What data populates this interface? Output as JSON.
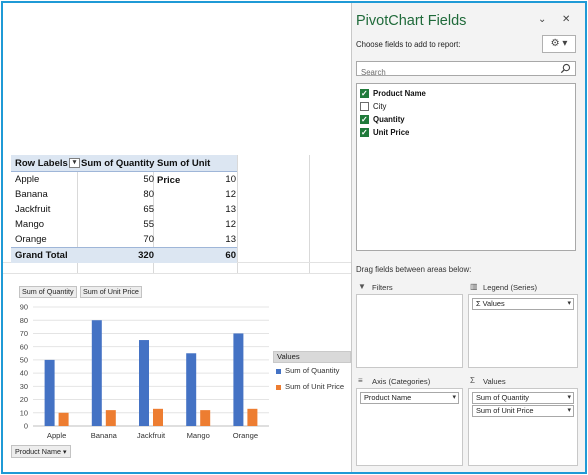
{
  "pivot_table": {
    "headers": [
      "Row Labels",
      "Sum of Quantity",
      "Sum of Unit Price"
    ],
    "rows": [
      [
        "Apple",
        "50",
        "10"
      ],
      [
        "Banana",
        "80",
        "12"
      ],
      [
        "Jackfruit",
        "65",
        "13"
      ],
      [
        "Mango",
        "55",
        "12"
      ],
      [
        "Orange",
        "70",
        "13"
      ]
    ],
    "total": [
      "Grand Total",
      "320",
      "60"
    ]
  },
  "chart_buttons": {
    "sum_quantity": "Sum of Quantity",
    "sum_unit_price": "Sum of Unit Price",
    "axis_field": "Product Name"
  },
  "chart_data": {
    "type": "bar",
    "categories": [
      "Apple",
      "Banana",
      "Jackfruit",
      "Mango",
      "Orange"
    ],
    "series": [
      {
        "name": "Sum of Quantity",
        "values": [
          50,
          80,
          65,
          55,
          70
        ],
        "color": "#4472c4"
      },
      {
        "name": "Sum of Unit Price",
        "values": [
          10,
          12,
          13,
          12,
          13
        ],
        "color": "#ed7d31"
      }
    ],
    "ylim": [
      0,
      90
    ],
    "yticks": [
      "0",
      "10",
      "20",
      "30",
      "40",
      "50",
      "60",
      "70",
      "80",
      "90"
    ],
    "legend_title": "Values",
    "legend_position": "right",
    "grid": true
  },
  "pane": {
    "title": "PivotChart Fields",
    "minimize_glyph": "⌄",
    "close_glyph": "✕",
    "subtitle": "Choose fields to add to report:",
    "search_placeholder": "Search",
    "fields": [
      {
        "label": "Product Name",
        "checked": true
      },
      {
        "label": "City",
        "checked": false
      },
      {
        "label": "Quantity",
        "checked": true
      },
      {
        "label": "Unit Price",
        "checked": true
      }
    ],
    "drag_label": "Drag fields between areas below:",
    "areas": {
      "filters": {
        "title": "Filters",
        "items": []
      },
      "legend": {
        "title": "Legend (Series)",
        "items": [
          "Values"
        ]
      },
      "axis": {
        "title": "Axis (Categories)",
        "items": [
          "Product Name"
        ]
      },
      "values": {
        "title": "Values",
        "items": [
          "Sum of Quantity",
          "Sum of Unit Price"
        ]
      }
    },
    "values_prefix": "Σ"
  },
  "colors": {
    "accent": "#1f9ad6",
    "title_green": "#1f6a3a",
    "checkbox_green": "#1f7a3a",
    "pivot_header_bg": "#dce6f2"
  }
}
